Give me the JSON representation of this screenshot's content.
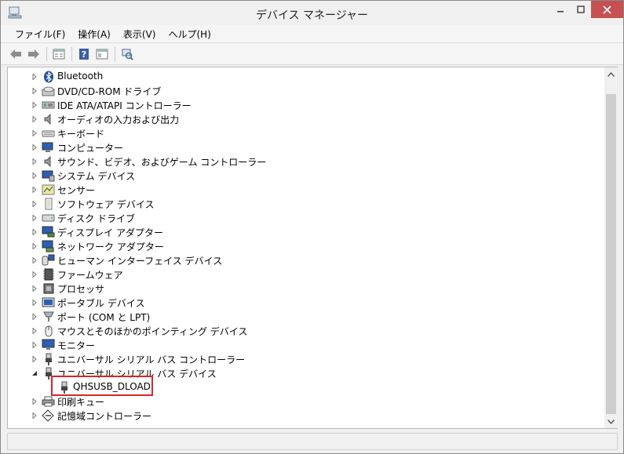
{
  "window": {
    "title": "デバイス マネージャー",
    "controls": {
      "minimize": "—",
      "maximize": "□",
      "close": "✕"
    }
  },
  "menu": {
    "items": [
      "ファイル(F)",
      "操作(A)",
      "表示(V)",
      "ヘルプ(H)"
    ]
  },
  "toolbar": {
    "buttons": [
      "back-arrow-icon",
      "forward-arrow-icon",
      "properties-grid-icon",
      "help-icon",
      "console-tree-icon",
      "scan-hardware-icon"
    ]
  },
  "tree": {
    "items": [
      {
        "label": "Bluetooth",
        "icon": "bluetooth-icon",
        "expanded": false
      },
      {
        "label": "DVD/CD-ROM ドライブ",
        "icon": "dvd-drive-icon",
        "expanded": false
      },
      {
        "label": "IDE ATA/ATAPI コントローラー",
        "icon": "ide-controller-icon",
        "expanded": false
      },
      {
        "label": "オーディオの入力および出力",
        "icon": "speaker-icon",
        "expanded": false
      },
      {
        "label": "キーボード",
        "icon": "keyboard-icon",
        "expanded": false
      },
      {
        "label": "コンピューター",
        "icon": "computer-icon",
        "expanded": false
      },
      {
        "label": "サウンド、ビデオ、およびゲーム コントローラー",
        "icon": "sound-icon",
        "expanded": false
      },
      {
        "label": "システム デバイス",
        "icon": "system-device-icon",
        "expanded": false
      },
      {
        "label": "センサー",
        "icon": "sensor-icon",
        "expanded": false
      },
      {
        "label": "ソフトウェア デバイス",
        "icon": "software-device-icon",
        "expanded": false
      },
      {
        "label": "ディスク ドライブ",
        "icon": "disk-drive-icon",
        "expanded": false
      },
      {
        "label": "ディスプレイ アダプター",
        "icon": "display-adapter-icon",
        "expanded": false
      },
      {
        "label": "ネットワーク アダプター",
        "icon": "network-adapter-icon",
        "expanded": false
      },
      {
        "label": "ヒューマン インターフェイス デバイス",
        "icon": "hid-icon",
        "expanded": false
      },
      {
        "label": "ファームウェア",
        "icon": "firmware-icon",
        "expanded": false
      },
      {
        "label": "プロセッサ",
        "icon": "processor-icon",
        "expanded": false
      },
      {
        "label": "ポータブル デバイス",
        "icon": "portable-device-icon",
        "expanded": false
      },
      {
        "label": "ポート (COM と LPT)",
        "icon": "port-icon",
        "expanded": false
      },
      {
        "label": "マウスとそのほかのポインティング デバイス",
        "icon": "mouse-icon",
        "expanded": false
      },
      {
        "label": "モニター",
        "icon": "monitor-icon",
        "expanded": false
      },
      {
        "label": "ユニバーサル シリアル バス コントローラー",
        "icon": "usb-icon",
        "expanded": false
      },
      {
        "label": "ユニバーサル シリアル バス デバイス",
        "icon": "usb-icon",
        "expanded": true
      },
      {
        "label": "印刷キュー",
        "icon": "printer-icon",
        "expanded": false
      },
      {
        "label": "記憶域コントローラー",
        "icon": "storage-controller-icon",
        "expanded": false
      }
    ],
    "child": {
      "label": "QHSUSB_DLOAD",
      "icon": "usb-plug-icon"
    }
  },
  "colors": {
    "highlight_border": "#d9232d",
    "close_button": "#c75050",
    "window_bg": "#f0f0f0"
  }
}
